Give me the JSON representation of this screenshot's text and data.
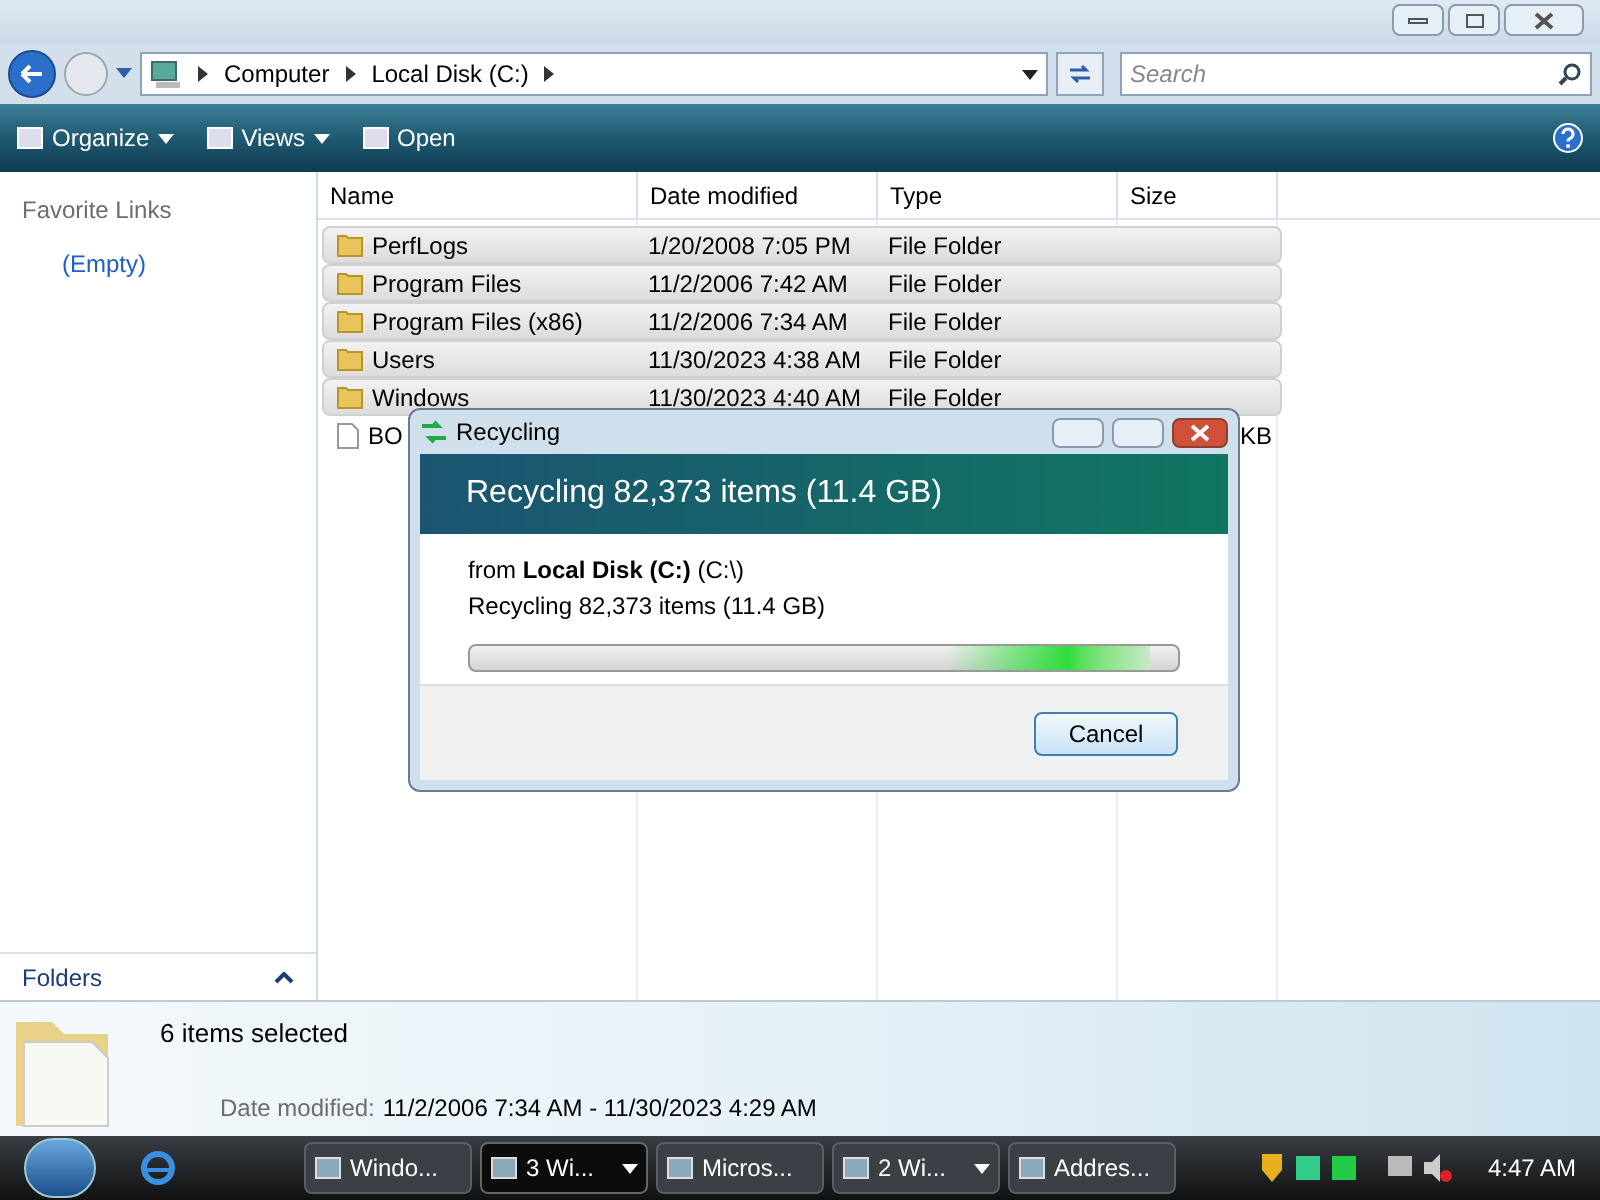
{
  "address_bar": {
    "crumbs": [
      "Computer",
      "Local Disk (C:)"
    ]
  },
  "search": {
    "placeholder": "Search"
  },
  "toolbar": [
    "Organize",
    "Views",
    "Open"
  ],
  "sidebar": {
    "heading": "Favorite Links",
    "items": [
      "(Empty)"
    ],
    "folders_label": "Folders"
  },
  "table": {
    "columns": [
      "Name",
      "Date modified",
      "Type",
      "Size"
    ],
    "rows": [
      {
        "kind": "folder",
        "name": "PerfLogs",
        "date": "1/20/2008 7:05 PM",
        "type": "File Folder",
        "size": "",
        "selected": true
      },
      {
        "kind": "folder",
        "name": "Program Files",
        "date": "11/2/2006 7:42 AM",
        "type": "File Folder",
        "size": "",
        "selected": true
      },
      {
        "kind": "folder",
        "name": "Program Files (x86)",
        "date": "11/2/2006 7:34 AM",
        "type": "File Folder",
        "size": "",
        "selected": true
      },
      {
        "kind": "folder",
        "name": "Users",
        "date": "11/30/2023 4:38 AM",
        "type": "File Folder",
        "size": "",
        "selected": true
      },
      {
        "kind": "folder",
        "name": "Windows",
        "date": "11/30/2023 4:40 AM",
        "type": "File Folder",
        "size": "",
        "selected": true
      },
      {
        "kind": "file",
        "name": "BO",
        "date": "",
        "type": "",
        "size": "KB",
        "selected": false
      }
    ]
  },
  "dialog": {
    "title": "Recycling",
    "headline": "Recycling 82,373 items (11.4 GB)",
    "from": "from **Local Disk (C:)** (C:\\)",
    "detail": "Recycling 82,373 items (11.4 GB)",
    "button": "Cancel",
    "level": 0.96
  },
  "details_pane": {
    "summary": "6 items selected",
    "label": "Date modified:",
    "value": "11/2/2006 7:34 AM - 11/30/2023 4:29 AM"
  },
  "taskbar": {
    "items": [
      {
        "label": "Windo...",
        "selected": false,
        "grouped": false
      },
      {
        "label": "3 Wi...",
        "selected": true,
        "grouped": true
      },
      {
        "label": "Micros...",
        "selected": false,
        "grouped": false
      },
      {
        "label": "2 Wi...",
        "selected": false,
        "grouped": true
      },
      {
        "label": "Addres...",
        "selected": false,
        "grouped": false
      }
    ],
    "clock": "4:47 AM"
  }
}
